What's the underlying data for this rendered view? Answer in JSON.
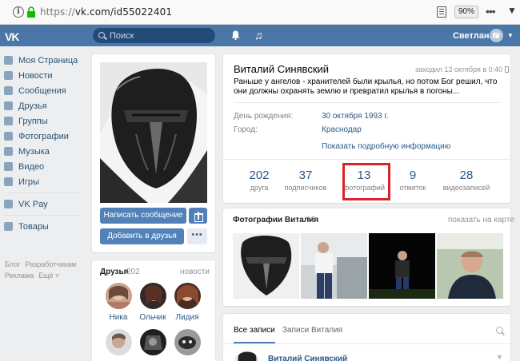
{
  "browser": {
    "url_proto": "https://",
    "url_rest": "vk.com/id55022401",
    "zoom": "90%",
    "more": "•••"
  },
  "header": {
    "logo": "VK",
    "search_placeholder": "Поиск",
    "user_name": "Светлана"
  },
  "sidebar": {
    "items": [
      {
        "label": "Моя Страница",
        "icon": "home-icon"
      },
      {
        "label": "Новости",
        "icon": "news-icon"
      },
      {
        "label": "Сообщения",
        "icon": "messages-icon"
      },
      {
        "label": "Друзья",
        "icon": "friends-icon"
      },
      {
        "label": "Группы",
        "icon": "groups-icon"
      },
      {
        "label": "Фотографии",
        "icon": "photos-icon"
      },
      {
        "label": "Музыка",
        "icon": "music-icon"
      },
      {
        "label": "Видео",
        "icon": "video-icon"
      },
      {
        "label": "Игры",
        "icon": "games-icon"
      }
    ],
    "items2": [
      {
        "label": "VK Pay",
        "icon": "vkpay-icon"
      }
    ],
    "items3": [
      {
        "label": "Товары",
        "icon": "goods-icon"
      }
    ],
    "footer": [
      "Блог",
      "Разработчикам",
      "Реклама",
      "Ещё ˅"
    ]
  },
  "profile": {
    "buttons": {
      "message": "Написать сообщение",
      "add_friend": "Добавить в друзья",
      "more": "•••"
    },
    "name": "Виталий Синявский",
    "online": "заходил 13 октября в 0:40",
    "status": "Раньше у ангелов - хранителей были крылья, но потом Бог решил, что они должны охранять землю и превратил крылья в погоны...",
    "info": [
      {
        "label": "День рождения:",
        "value": "30 октября 1993 г."
      },
      {
        "label": "Город:",
        "value": "Краснодар"
      }
    ],
    "show_more": "Показать подробную информацию",
    "counters": [
      {
        "num": "202",
        "label": "друга"
      },
      {
        "num": "37",
        "label": "подписчиков"
      },
      {
        "num": "13",
        "label": "фотографий"
      },
      {
        "num": "9",
        "label": "отметок"
      },
      {
        "num": "28",
        "label": "видеозаписей"
      }
    ]
  },
  "friends": {
    "title": "Друзья",
    "count": "202",
    "link": "новости",
    "items": [
      {
        "name": "Ника"
      },
      {
        "name": "Ольчик"
      },
      {
        "name": "Лидия"
      },
      {
        "name": ""
      },
      {
        "name": ""
      },
      {
        "name": ""
      }
    ]
  },
  "photos": {
    "title": "Фотографии Виталия",
    "count": "13",
    "map_link": "показать на карте"
  },
  "wall": {
    "tab_all": "Все записи",
    "tab_own": "Записи Виталия",
    "post_author": "Виталий Синявский"
  },
  "colors": {
    "header": "#4a76a8",
    "link": "#2a5885",
    "button": "#5181b8",
    "highlight": "#d8232a"
  }
}
